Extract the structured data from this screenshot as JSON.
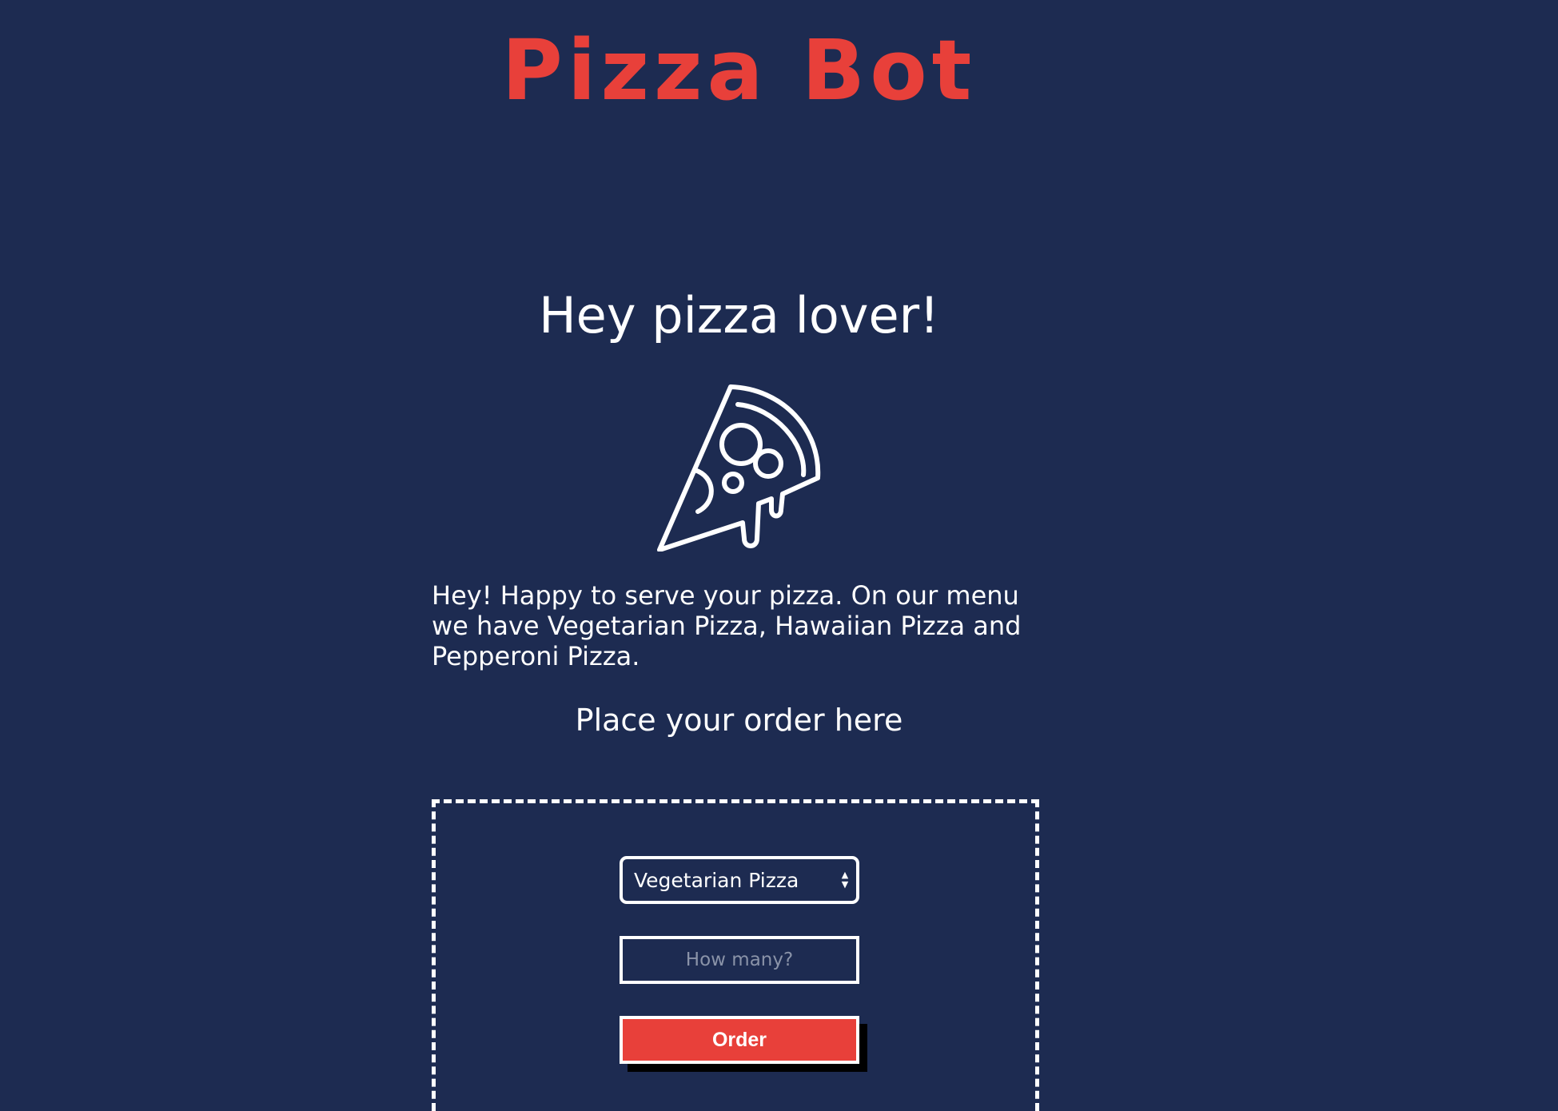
{
  "brand": {
    "logo_text": "Pizza Bot",
    "logo_color": "#e8403a",
    "background_color": "#1d2b51"
  },
  "hero": {
    "headline": "Hey pizza lover!",
    "icon": "pizza-slice-icon"
  },
  "intro": {
    "text": "Hey! Happy to serve your pizza. On our menu we have Vegetarian Pizza, Hawaiian Pizza and Pepperoni Pizza."
  },
  "order": {
    "heading": "Place your order here",
    "pizza_select": {
      "selected": "Vegetarian Pizza",
      "icon": "up-down-arrows-icon"
    },
    "quantity": {
      "placeholder": "How many?",
      "value": ""
    },
    "submit_label": "Order",
    "button_color": "#e8403a"
  }
}
